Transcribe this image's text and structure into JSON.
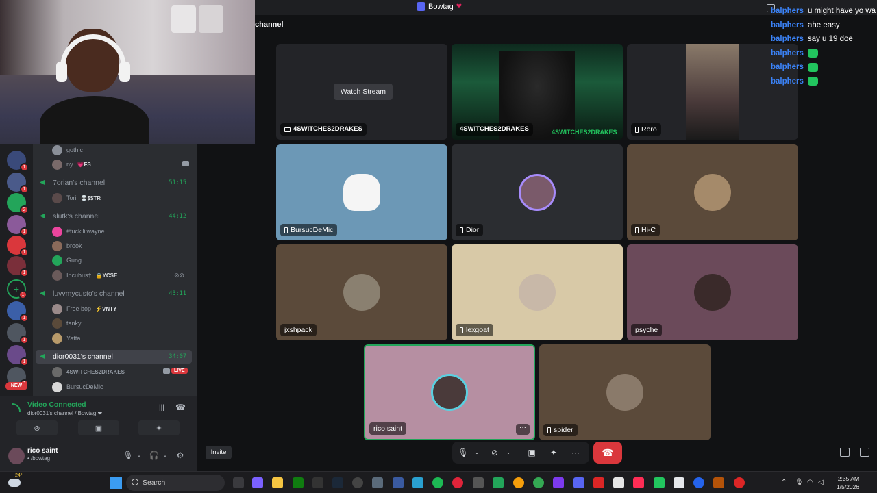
{
  "window": {
    "title": "Bowtag",
    "heart": "❤"
  },
  "topic": "channel",
  "server_rail": {
    "badge_counts": [
      "1",
      "1",
      "2",
      "1",
      "1",
      "1",
      "1",
      "1",
      "1",
      "1",
      "1"
    ],
    "new_badge": "NEW"
  },
  "channels": [
    {
      "name": "",
      "time": "",
      "members": [
        {
          "name": "gothlc",
          "tag": ""
        },
        {
          "name": "ny",
          "tag": "💗FS"
        }
      ]
    },
    {
      "name": "7orian's channel",
      "time": "51:15",
      "members": [
        {
          "name": "Tori",
          "tag": "💀$$TR"
        }
      ]
    },
    {
      "name": "slutk's channel",
      "time": "44:12",
      "members": [
        {
          "name": "#fuckllilwayne",
          "tag": ""
        },
        {
          "name": "brook",
          "tag": ""
        },
        {
          "name": "Gung",
          "tag": ""
        },
        {
          "name": "Incubus†",
          "tag": "🔒YCSE"
        }
      ]
    },
    {
      "name": "luvvmycusto's channel",
      "time": "43:11",
      "members": [
        {
          "name": "Free bop",
          "tag": "⚡VNTY"
        },
        {
          "name": "tanky",
          "tag": ""
        },
        {
          "name": "Yatta",
          "tag": ""
        }
      ]
    },
    {
      "name": "dior0031's channel",
      "time": "34:07",
      "members": [
        {
          "name": "4SWITCHES2DRAKES",
          "tag": "",
          "live": "LIVE"
        },
        {
          "name": "BursucDeMic",
          "tag": ""
        }
      ]
    }
  ],
  "voice_status": {
    "title": "Video Connected",
    "subtitle": "dior0031's channel / Bowtag ❤"
  },
  "user": {
    "name": "rico saint",
    "status": "• /bowtag"
  },
  "tiles": [
    {
      "label": "4SWITCHES2DRAKES",
      "button": "Watch Stream"
    },
    {
      "label": "4SWITCHES2DRAKES",
      "overlay": "4SWITCHES2DRAKES"
    },
    {
      "label": "Roro"
    },
    {
      "label": "BursucDeMic"
    },
    {
      "label": "Dior"
    },
    {
      "label": "Hi-C"
    },
    {
      "label": "jxshpack"
    },
    {
      "label": "lexgoat"
    },
    {
      "label": "psyche"
    },
    {
      "label": "rico saint",
      "more": "···"
    },
    {
      "label": "spider"
    }
  ],
  "colors": {
    "accent": "#5865f2",
    "online": "#23a55a",
    "danger": "#da373c",
    "tile_blue": "#6c98b6",
    "tile_brown": "#5b4a3a",
    "tile_tan": "#d8c9a7",
    "tile_mauve": "#6b4a5a",
    "tile_pink": "#b68fa2"
  },
  "chat": [
    {
      "user": "balphers",
      "msg": "u might have yo wa"
    },
    {
      "user": "balphers",
      "msg": "ahe easy"
    },
    {
      "user": "balphers",
      "msg": "say u 19 doe"
    },
    {
      "user": "balphers",
      "msg": "",
      "emote": true
    },
    {
      "user": "balphers",
      "msg": "",
      "emote": true
    },
    {
      "user": "balphers",
      "msg": "",
      "emote": true
    }
  ],
  "controls": {
    "invite": "Invite",
    "hangup_icon": "phone-hangup-icon"
  },
  "taskbar": {
    "temp": "24°",
    "search": "Search",
    "time": "2:35 AM",
    "date": "1/5/2026"
  }
}
